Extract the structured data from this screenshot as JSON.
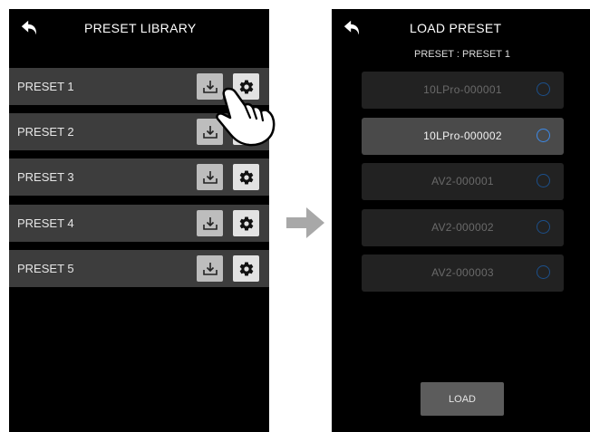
{
  "left": {
    "title": "PRESET LIBRARY",
    "back_icon": "undo-arrow-icon",
    "rows": [
      {
        "label": "PRESET 1",
        "load_icon": "download-icon",
        "settings_icon": "gear-icon"
      },
      {
        "label": "PRESET 2",
        "load_icon": "download-icon",
        "settings_icon": "gear-icon"
      },
      {
        "label": "PRESET 3",
        "load_icon": "download-icon",
        "settings_icon": "gear-icon"
      },
      {
        "label": "PRESET 4",
        "load_icon": "download-icon",
        "settings_icon": "gear-icon"
      },
      {
        "label": "PRESET 5",
        "load_icon": "download-icon",
        "settings_icon": "gear-icon"
      }
    ]
  },
  "right": {
    "title": "LOAD PRESET",
    "subtitle": "PRESET : PRESET 1",
    "back_icon": "undo-arrow-icon",
    "items": [
      {
        "name": "10LPro-000001",
        "selected": false
      },
      {
        "name": "10LPro-000002",
        "selected": true
      },
      {
        "name": "AV2-000001",
        "selected": false
      },
      {
        "name": "AV2-000002",
        "selected": false
      },
      {
        "name": "AV2-000003",
        "selected": false
      }
    ],
    "load_label": "LOAD"
  },
  "transition_icon": "right-arrow-icon",
  "pointer_icon": "tapping-hand-icon",
  "colors": {
    "screen_bg": "#000000",
    "row_bg": "#3d3d3d",
    "selected_item_bg": "#4a4a4a",
    "radio_selected": "#3d8ae8",
    "arrow": "#a8a8a8"
  }
}
